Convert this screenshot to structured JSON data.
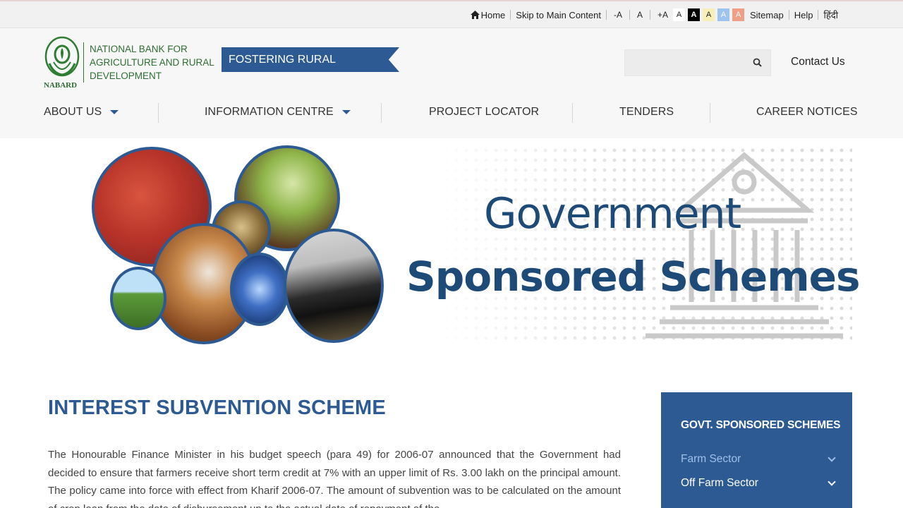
{
  "topbar": {
    "home": "Home",
    "skip": "Skip to Main Content",
    "font_minus": "-A",
    "font_normal": "A",
    "font_plus": "+A",
    "contrast_options": [
      "A",
      "A",
      "A",
      "A",
      "A"
    ],
    "sitemap": "Sitemap",
    "help": "Help",
    "hindi": "हिंदी"
  },
  "header": {
    "logo_caption": "NABARD",
    "org_line1": "NATIONAL BANK FOR",
    "org_line2": "AGRICULTURE AND RURAL",
    "org_line3": "DEVELOPMENT",
    "tagline": "FOSTERING RURAL PROSPERITY",
    "search_placeholder": "",
    "contact": "Contact Us"
  },
  "nav": {
    "items": [
      {
        "label": "ABOUT US",
        "dropdown": true
      },
      {
        "label": "INFORMATION CENTRE",
        "dropdown": true
      },
      {
        "label": "PROJECT LOCATOR",
        "dropdown": false
      },
      {
        "label": "TENDERS",
        "dropdown": false
      },
      {
        "label": "CAREER NOTICES",
        "dropdown": false
      }
    ]
  },
  "banner": {
    "line1": "Government",
    "line2": "Sponsored Schemes"
  },
  "main": {
    "title": "INTEREST SUBVENTION SCHEME",
    "paragraph": "The Honourable Finance Minister in his budget speech (para 49) for 2006-07 announced that the Government had decided to ensure that farmers receive short term credit at 7% with an upper limit of Rs. 3.00 lakh on the principal amount. The policy came into force with effect from Kharif 2006-07. The amount of subvention was to be calculated on the amount of crop loan from the date of disbursement up to the actual date of repayment of the"
  },
  "sidebar": {
    "title": "GOVT. SPONSORED SCHEMES",
    "items": [
      {
        "label": "Farm Sector"
      },
      {
        "label": "Off Farm Sector"
      }
    ]
  },
  "colors": {
    "brand_blue": "#2d5a93",
    "nabard_green": "#2e7d32",
    "banner_text": "#1e4a78"
  }
}
